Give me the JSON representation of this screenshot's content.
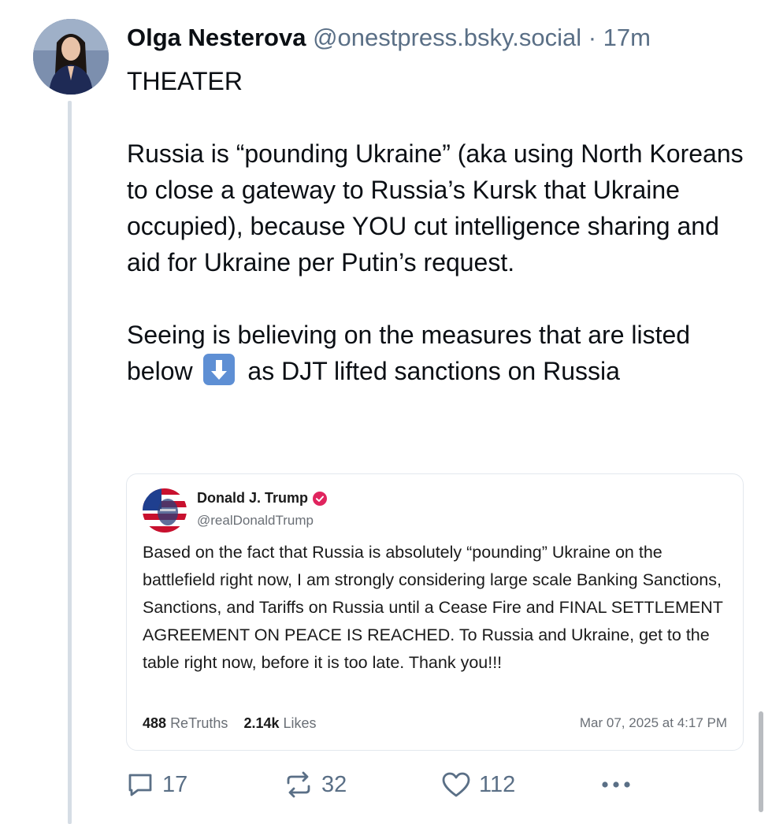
{
  "post": {
    "author_name": "Olga Nesterova",
    "author_handle": "@onestpress.bsky.social",
    "separator": "·",
    "time": "17m",
    "text_paragraphs": [
      "THEATER",
      "Russia is “pounding Ukraine” (aka using North Koreans to close a gateway to Russia’s Kursk that Ukraine occupied), because YOU cut intelligence sharing and aid for Ukraine per Putin’s request."
    ],
    "text_last_before_emoji": "Seeing is believing on the measures that are listed below",
    "text_last_after_emoji": " as DJT lifted sanctions on Russia",
    "emoji_icon": "down-arrow-emoji"
  },
  "quote": {
    "author_name": "Donald J. Trump",
    "verified_icon": "verified-badge-icon",
    "verified_color": "#e0245e",
    "author_handle": "@realDonaldTrump",
    "body": "Based on the fact that Russia is absolutely “pounding” Ukraine on the battlefield right now, I am strongly considering large scale Banking Sanctions, Sanctions, and Tariffs on Russia until a Cease Fire and FINAL SETTLEMENT AGREEMENT ON PEACE IS REACHED. To Russia and Ukraine, get to the table right now, before it is too late. Thank you!!!",
    "retruths_count": "488",
    "retruths_label": "ReTruths",
    "likes_count": "2.14k",
    "likes_label": "Likes",
    "date": "Mar 07, 2025 at 4:17 PM"
  },
  "actions": {
    "replies": "17",
    "reposts": "32",
    "likes": "112",
    "more_icon": "more-icon"
  },
  "colors": {
    "secondary_text": "#5a6f86",
    "thread_line": "#d6dde5",
    "emoji_bg": "#5e8fd4"
  }
}
